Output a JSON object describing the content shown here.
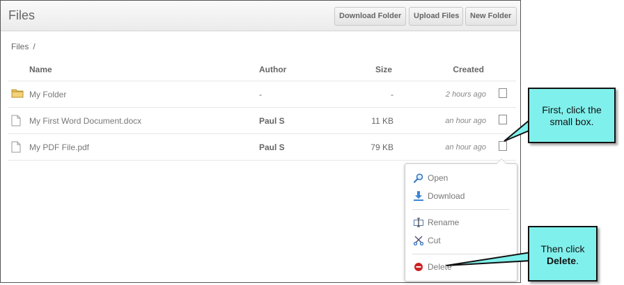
{
  "header": {
    "title": "Files",
    "buttons": [
      "Download Folder",
      "Upload Files",
      "New Folder"
    ]
  },
  "breadcrumb": {
    "root": "Files",
    "separator": "/"
  },
  "table": {
    "columns": {
      "name": "Name",
      "author": "Author",
      "size": "Size",
      "created": "Created"
    },
    "rows": [
      {
        "type": "folder",
        "name": "My Folder",
        "author": "-",
        "size": "-",
        "created": "2 hours ago"
      },
      {
        "type": "file",
        "name": "My First Word Document.docx",
        "author": "Paul S",
        "size": "11 KB",
        "created": "an hour ago"
      },
      {
        "type": "file",
        "name": "My PDF File.pdf",
        "author": "Paul S",
        "size": "79 KB",
        "created": "an hour ago"
      }
    ]
  },
  "context_menu": {
    "items": [
      {
        "label": "Open",
        "icon": "magnifier-icon"
      },
      {
        "label": "Download",
        "icon": "download-arrow-icon"
      },
      {
        "label": "Rename",
        "icon": "rename-icon"
      },
      {
        "label": "Cut",
        "icon": "scissors-icon"
      },
      {
        "label": "Delete",
        "icon": "delete-icon"
      }
    ]
  },
  "callouts": {
    "first": "First, click the small box.",
    "second_prefix": "Then click",
    "second_bold": "Delete",
    "second_suffix": "."
  },
  "colors": {
    "callout_fill": "#80f0ec",
    "delete_icon": "#cc2222",
    "folder": "#e8c45a"
  }
}
